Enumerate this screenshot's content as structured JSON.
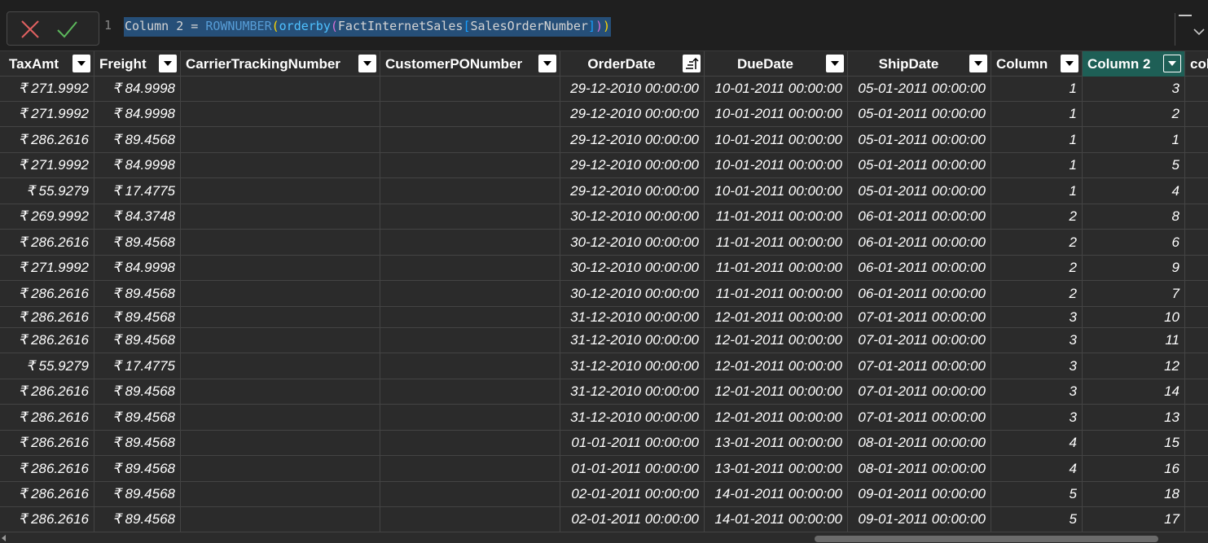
{
  "formula_bar": {
    "line_number": "1",
    "tokens": {
      "col": "Column 2",
      "eq": " = ",
      "fn": "ROWNUMBER",
      "p1o": "(",
      "fn2": "orderby",
      "p2o": "(",
      "table": "FactInternetSales",
      "p3o": "[",
      "column": "SalesOrderNumber",
      "p3c": "]",
      "p2c": ")",
      "p1c": ")"
    },
    "cancel_icon": "x-icon",
    "commit_icon": "check-icon",
    "expand_icon": "chevron-down-icon"
  },
  "colors": {
    "active_header": "#1e5f56",
    "background": "#2b2b2b",
    "selection": "#264f78"
  },
  "columns": [
    "TaxAmt",
    "Freight",
    "CarrierTrackingNumber",
    "CustomerPONumber",
    "OrderDate",
    "DueDate",
    "ShipDate",
    "Column",
    "Column 2",
    "col"
  ],
  "rows": [
    [
      "₹ 271.9992",
      "₹ 84.9998",
      "",
      "",
      "29-12-2010 00:00:00",
      "10-01-2011 00:00:00",
      "05-01-2011 00:00:00",
      "1",
      "3"
    ],
    [
      "₹ 271.9992",
      "₹ 84.9998",
      "",
      "",
      "29-12-2010 00:00:00",
      "10-01-2011 00:00:00",
      "05-01-2011 00:00:00",
      "1",
      "2"
    ],
    [
      "₹ 286.2616",
      "₹ 89.4568",
      "",
      "",
      "29-12-2010 00:00:00",
      "10-01-2011 00:00:00",
      "05-01-2011 00:00:00",
      "1",
      "1"
    ],
    [
      "₹ 271.9992",
      "₹ 84.9998",
      "",
      "",
      "29-12-2010 00:00:00",
      "10-01-2011 00:00:00",
      "05-01-2011 00:00:00",
      "1",
      "5"
    ],
    [
      "₹ 55.9279",
      "₹ 17.4775",
      "",
      "",
      "29-12-2010 00:00:00",
      "10-01-2011 00:00:00",
      "05-01-2011 00:00:00",
      "1",
      "4"
    ],
    [
      "₹ 269.9992",
      "₹ 84.3748",
      "",
      "",
      "30-12-2010 00:00:00",
      "11-01-2011 00:00:00",
      "06-01-2011 00:00:00",
      "2",
      "8"
    ],
    [
      "₹ 286.2616",
      "₹ 89.4568",
      "",
      "",
      "30-12-2010 00:00:00",
      "11-01-2011 00:00:00",
      "06-01-2011 00:00:00",
      "2",
      "6"
    ],
    [
      "₹ 271.9992",
      "₹ 84.9998",
      "",
      "",
      "30-12-2010 00:00:00",
      "11-01-2011 00:00:00",
      "06-01-2011 00:00:00",
      "2",
      "9"
    ],
    [
      "₹ 286.2616",
      "₹ 89.4568",
      "",
      "",
      "30-12-2010 00:00:00",
      "11-01-2011 00:00:00",
      "06-01-2011 00:00:00",
      "2",
      "7"
    ],
    [
      "₹ 286.2616",
      "₹ 89.4568",
      "",
      "",
      "31-12-2010 00:00:00",
      "12-01-2011 00:00:00",
      "07-01-2011 00:00:00",
      "3",
      "10"
    ],
    [
      "₹ 286.2616",
      "₹ 89.4568",
      "",
      "",
      "31-12-2010 00:00:00",
      "12-01-2011 00:00:00",
      "07-01-2011 00:00:00",
      "3",
      "11"
    ],
    [
      "₹ 55.9279",
      "₹ 17.4775",
      "",
      "",
      "31-12-2010 00:00:00",
      "12-01-2011 00:00:00",
      "07-01-2011 00:00:00",
      "3",
      "12"
    ],
    [
      "₹ 286.2616",
      "₹ 89.4568",
      "",
      "",
      "31-12-2010 00:00:00",
      "12-01-2011 00:00:00",
      "07-01-2011 00:00:00",
      "3",
      "14"
    ],
    [
      "₹ 286.2616",
      "₹ 89.4568",
      "",
      "",
      "31-12-2010 00:00:00",
      "12-01-2011 00:00:00",
      "07-01-2011 00:00:00",
      "3",
      "13"
    ],
    [
      "₹ 286.2616",
      "₹ 89.4568",
      "",
      "",
      "01-01-2011 00:00:00",
      "13-01-2011 00:00:00",
      "08-01-2011 00:00:00",
      "4",
      "15"
    ],
    [
      "₹ 286.2616",
      "₹ 89.4568",
      "",
      "",
      "01-01-2011 00:00:00",
      "13-01-2011 00:00:00",
      "08-01-2011 00:00:00",
      "4",
      "16"
    ],
    [
      "₹ 286.2616",
      "₹ 89.4568",
      "",
      "",
      "02-01-2011 00:00:00",
      "14-01-2011 00:00:00",
      "09-01-2011 00:00:00",
      "5",
      "18"
    ],
    [
      "₹ 286.2616",
      "₹ 89.4568",
      "",
      "",
      "02-01-2011 00:00:00",
      "14-01-2011 00:00:00",
      "09-01-2011 00:00:00",
      "5",
      "17"
    ]
  ]
}
